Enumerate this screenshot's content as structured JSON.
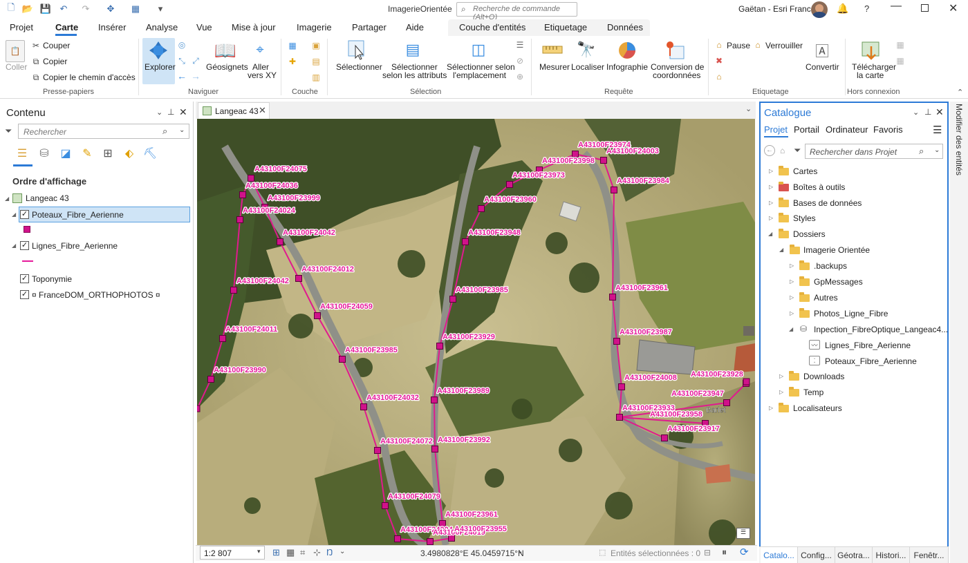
{
  "app": {
    "title": "ImagerieOrientée",
    "search_placeholder": "Recherche de commande (Alt+Q)",
    "user": "Gaëtan - Esri France",
    "help": "?"
  },
  "menu": {
    "tabs": [
      "Projet",
      "Carte",
      "Insérer",
      "Analyse",
      "Vue",
      "Mise à jour",
      "Imagerie",
      "Partager",
      "Aide"
    ],
    "active": "Carte",
    "contextual_tabs": [
      "Couche d'entités",
      "Etiquetage",
      "Données"
    ]
  },
  "ribbon": {
    "clipboard": {
      "paste": "Coller",
      "cut": "Couper",
      "copy": "Copier",
      "copy_path": "Copier le chemin d'accès",
      "group": "Presse-papiers"
    },
    "navigate": {
      "explore": "Explorer",
      "bookmarks": "Géosignets",
      "goto_1": "Aller",
      "goto_2": "vers XY",
      "group": "Naviguer"
    },
    "layer": {
      "group": "Couche"
    },
    "selection": {
      "select": "Sélectionner",
      "by_attr_1": "Sélectionner",
      "by_attr_2": "selon les attributs",
      "by_loc_1": "Sélectionner selon",
      "by_loc_2": "l'emplacement",
      "group": "Sélection"
    },
    "inquiry": {
      "measure": "Mesurer",
      "locate": "Localiser",
      "infographics": "Infographie",
      "convert_1": "Conversion de",
      "convert_2": "coordonnées",
      "group": "Requête"
    },
    "labeling": {
      "pause": "Pause",
      "lock": "Verrouiller",
      "convert": "Convertir",
      "group": "Etiquetage"
    },
    "offline": {
      "download_1": "Télécharger",
      "download_2": "la carte",
      "group": "Hors connexion"
    }
  },
  "contents": {
    "title": "Contenu",
    "search_placeholder": "Rechercher",
    "drawing_order": "Ordre d'affichage",
    "map": "Langeac 43",
    "layers": [
      {
        "name": "Poteaux_Fibre_Aerienne",
        "checked": true
      },
      {
        "name": "Lignes_Fibre_Aerienne",
        "checked": true
      },
      {
        "name": "Toponymie",
        "checked": true
      },
      {
        "name": "¤ FranceDOM_ORTHOPHOTOS ¤",
        "checked": true
      }
    ]
  },
  "map": {
    "tab": "Langeac 43",
    "scale": "1:2 807",
    "coords": "3.4980828°E 45.0459715°N",
    "selected": "Entités sélectionnées : 0",
    "place_label": "Barlet",
    "line_color": "#e01a8e",
    "poles": [
      "A43100F24075",
      "A43100F24036",
      "A43100F23999",
      "A43100F24024",
      "A43100F24042",
      "A43100F24012",
      "A43100F24042",
      "A43100F24059",
      "A43100F24011",
      "A43100F23985",
      "A43100F23990",
      "A43100F24032",
      "A43100F24072",
      "A43100F24079",
      "A43100F24004",
      "A43100F24019",
      "A43100F23974",
      "A43100F23998",
      "A43100F24003",
      "A43100F23973",
      "A43100F23984",
      "A43100F23960",
      "A43100F23948",
      "A43100F23985",
      "A43100F23955",
      "A43100F23961",
      "A43100F23929",
      "A43100F23987",
      "A43100F23989",
      "A43100F24008",
      "A43100F23992",
      "A43100F23933",
      "A43100F23961",
      "A43100F23917",
      "A43100F23928",
      "A43100F23947",
      "A43100F23958"
    ]
  },
  "catalog": {
    "title": "Catalogue",
    "tabs": [
      "Projet",
      "Portail",
      "Ordinateur",
      "Favoris"
    ],
    "search_placeholder": "Rechercher dans Projet",
    "items": [
      {
        "label": "Cartes"
      },
      {
        "label": "Boîtes à outils"
      },
      {
        "label": "Bases de données"
      },
      {
        "label": "Styles"
      },
      {
        "label": "Dossiers"
      },
      {
        "label": "Imagerie Orientée"
      },
      {
        "label": ".backups"
      },
      {
        "label": "GpMessages"
      },
      {
        "label": "Autres"
      },
      {
        "label": "Photos_Ligne_Fibre"
      },
      {
        "label": "Inpection_FibreOptique_Langeac4..."
      },
      {
        "label": "Lignes_Fibre_Aerienne"
      },
      {
        "label": "Poteaux_Fibre_Aerienne"
      },
      {
        "label": "Downloads"
      },
      {
        "label": "Temp"
      },
      {
        "label": "Localisateurs"
      }
    ],
    "bottom_tabs": [
      "Catalo...",
      "Config...",
      "Géotra...",
      "Histori...",
      "Fenêtr..."
    ]
  },
  "side": {
    "vertical_tab": "Modifier des entités"
  }
}
